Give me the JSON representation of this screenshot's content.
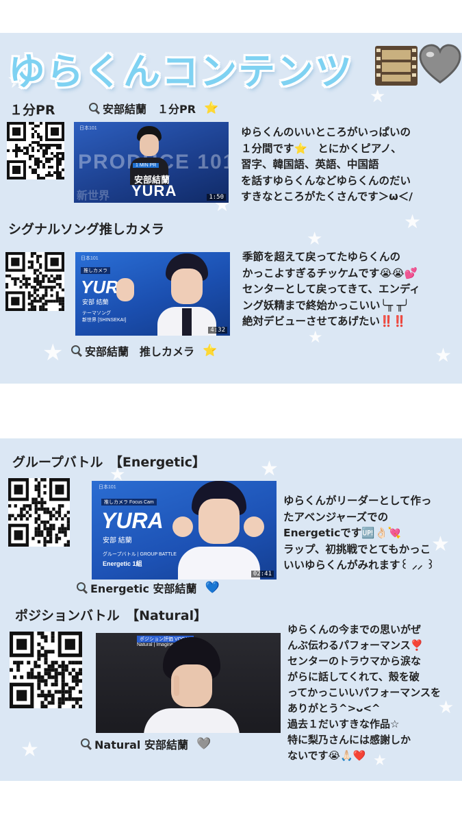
{
  "page": {
    "title": "ゆらくんコンテンツ",
    "title_icon": "film-strip-icon",
    "title_heart": "grey-heart-icon"
  },
  "sections": [
    {
      "heading": "１分PR",
      "search_text": "安部結蘭　１分PR",
      "search_emoji": "⭐",
      "video": {
        "badge": "1 MIN PR",
        "program": "PRODUCE 101",
        "name_jp": "安部結蘭",
        "name_en": "YURA",
        "caption": "新世界",
        "duration": "1:50"
      },
      "description": [
        "ゆらくんのいいところがいっぱいの",
        "１分間です⭐　とにかくピアノ、",
        "習字、韓国語、英語、中国語",
        "を話すゆらくんなどゆらくんのだい",
        "すきなところがたくさんです＞ω＜/"
      ]
    },
    {
      "heading": "シグナルソング推しカメラ",
      "search_text": "安部結蘭　推しカメラ",
      "search_emoji": "⭐",
      "video": {
        "badge": "推しカメラ",
        "name_en": "YURA",
        "name_jp": "安部 結蘭",
        "caption1": "テーマソング",
        "caption2": "新世界 [SHINSEKAI]",
        "duration": "4:32"
      },
      "description": [
        "季節を超えて戻ってたゆらくんの",
        "かっこよすぎるチッケムです😭😭💕",
        "センターとして戻ってきて、エンディ",
        "ング妖精まで終始かっこいい╰╥ ╥╯",
        "絶対デビューさせてあげたい‼️‼️"
      ]
    },
    {
      "heading": "グループバトル　【Energetic】",
      "search_text": "Energetic 安部結蘭",
      "search_emoji": "💙",
      "video": {
        "badge": "推しカメラ Focus Cam",
        "name_en": "YURA",
        "name_jp": "安部 結蘭",
        "caption1": "グループバトル | GROUP BATTLE",
        "caption2": "Energetic 1組",
        "duration": "02:41"
      },
      "description": [
        "ゆらくんがリーダーとして作っ",
        "たアベンジャーズでの",
        "Energeticです🆙👌🏻💘",
        "ラップ、初挑戦でとてもかっこ",
        "いいゆらくんがみれます꒰ ⸝⸝ ꒱"
      ]
    },
    {
      "heading": "ポジションバトル　【Natural】",
      "search_text": "Natural 安部結蘭",
      "search_emoji": "🩶",
      "video": {
        "badge": "ポジション評価 VOCAL",
        "caption1": "Natural | Imagine Dragons"
      },
      "description": [
        "ゆらくんの今までの思いがぜ",
        "んぶ伝わるパフォーマンス❣️",
        "センターのトラウマから涙な",
        "がらに話してくれて、殻を破",
        "ってかっこいいパフォーマンスを",
        "ありがとう^>ᴗ<^",
        "過去１だいすきな作品☆",
        "特に梨乃さんには感謝しか",
        "ないです😭🙏🏻❤️"
      ]
    }
  ],
  "colors": {
    "panel": "#dbe7f4",
    "title": "#7fd2f2",
    "video_blue": "#1a3f8c"
  }
}
